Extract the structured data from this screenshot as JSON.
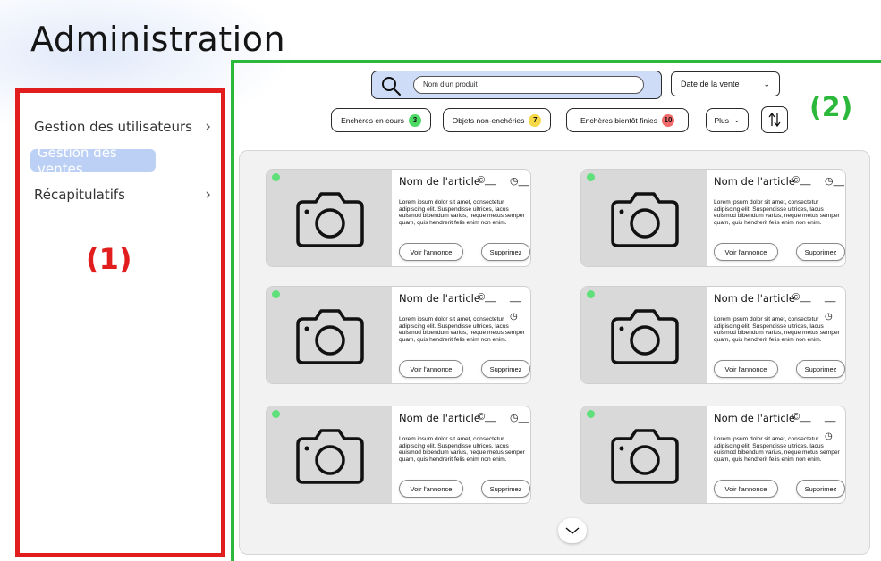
{
  "page": {
    "title": "Administration"
  },
  "sidebar": {
    "items": [
      {
        "label": "Gestion des utilisateurs",
        "has_chevron": true,
        "active": false
      },
      {
        "label": "Gestion des ventes",
        "has_chevron": false,
        "active": true
      },
      {
        "label": "Récapitulatifs",
        "has_chevron": true,
        "active": false
      }
    ],
    "region_label": "(1)"
  },
  "main": {
    "region_label": "(2)",
    "search": {
      "placeholder": "Nom d'un produit"
    },
    "sort_select": {
      "value": "Date de la vente"
    },
    "filters": [
      {
        "label": "Enchères en cours",
        "count": "3",
        "color": "#4cd964"
      },
      {
        "label": "Objets non-enchéries",
        "count": "7",
        "color": "#f7d948"
      },
      {
        "label": "Enchères bientôt finies",
        "count": "10",
        "color": "#f26a6a"
      },
      {
        "label": "Plus"
      }
    ],
    "cards": [
      {
        "title": "Nom de l'article",
        "price": "©__",
        "time": "◷__",
        "layout": "inline"
      },
      {
        "title": "Nom de l'article",
        "price": "©__",
        "time": "◷__",
        "layout": "inline"
      },
      {
        "title": "Nom de l'article",
        "price": "©__",
        "time": "__",
        "layout": "split"
      },
      {
        "title": "Nom de l'article",
        "price": "©__",
        "time": "__",
        "layout": "split"
      },
      {
        "title": "Nom de l'article",
        "price": "©__",
        "time": "◷__",
        "layout": "inline"
      },
      {
        "title": "Nom de l'article",
        "price": "©__",
        "time": "__",
        "layout": "split"
      }
    ],
    "card_text": {
      "description": "Lorem ipsum dolor sit amet, consectetur adipiscing elit. Suspendisse ultrices, lacus euismod bibendum varius, neque metus semper quam, quis hendrerit felis enim non enim.",
      "view_label": "Voir l'annonce",
      "delete_label": "Supprimez"
    }
  },
  "colors": {
    "sidebar_border": "#e11d1d",
    "main_border": "#2bb83b",
    "active_item": "#bcd0f5",
    "status_dot": "#5fe07a"
  }
}
